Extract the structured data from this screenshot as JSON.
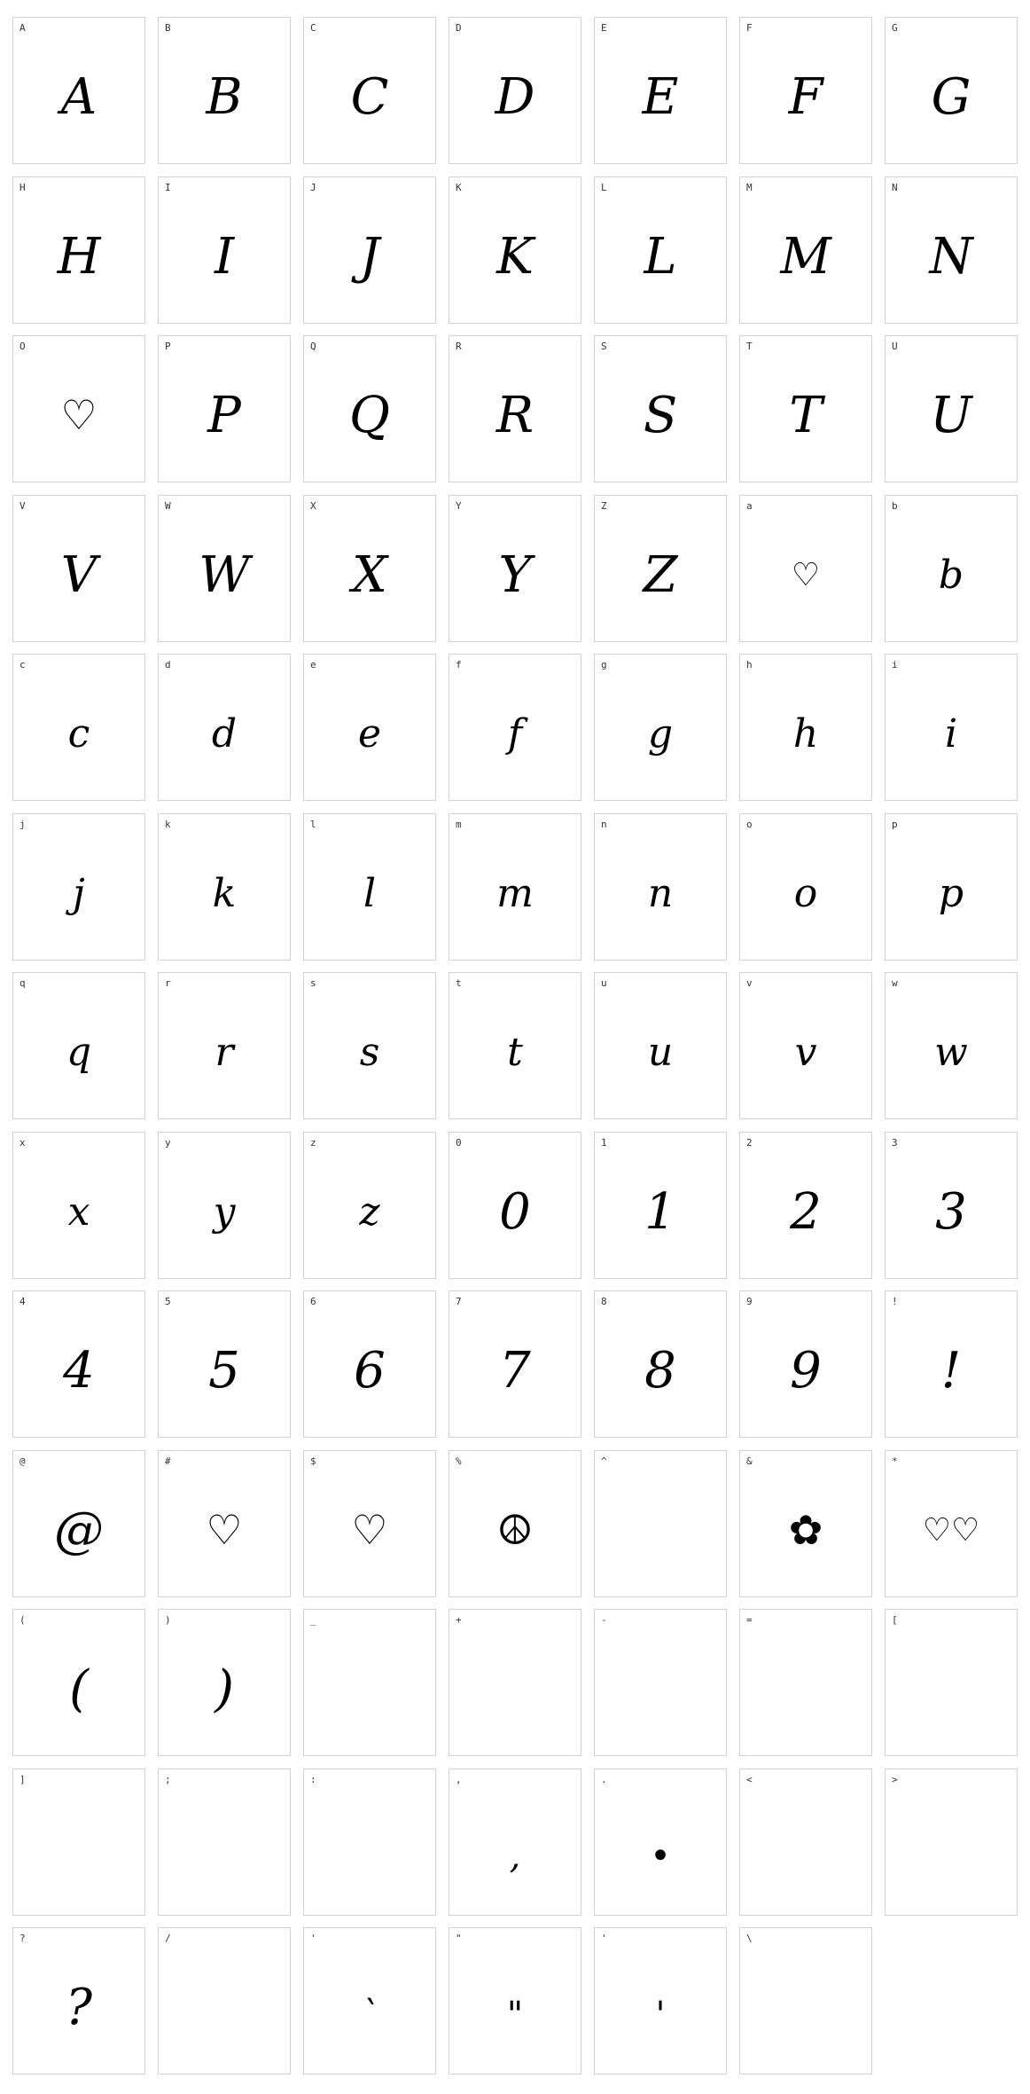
{
  "glyph_map": {
    "cells": [
      {
        "label": "A",
        "glyph": "A"
      },
      {
        "label": "B",
        "glyph": "B"
      },
      {
        "label": "C",
        "glyph": "C"
      },
      {
        "label": "D",
        "glyph": "D"
      },
      {
        "label": "E",
        "glyph": "E"
      },
      {
        "label": "F",
        "glyph": "F"
      },
      {
        "label": "G",
        "glyph": "G"
      },
      {
        "label": "H",
        "glyph": "H"
      },
      {
        "label": "I",
        "glyph": "I"
      },
      {
        "label": "J",
        "glyph": "J"
      },
      {
        "label": "K",
        "glyph": "K"
      },
      {
        "label": "L",
        "glyph": "L"
      },
      {
        "label": "M",
        "glyph": "M"
      },
      {
        "label": "N",
        "glyph": "N"
      },
      {
        "label": "O",
        "glyph": "♡",
        "style": "decor"
      },
      {
        "label": "P",
        "glyph": "P"
      },
      {
        "label": "Q",
        "glyph": "Q"
      },
      {
        "label": "R",
        "glyph": "R"
      },
      {
        "label": "S",
        "glyph": "S"
      },
      {
        "label": "T",
        "glyph": "T"
      },
      {
        "label": "U",
        "glyph": "U"
      },
      {
        "label": "V",
        "glyph": "V"
      },
      {
        "label": "W",
        "glyph": "W"
      },
      {
        "label": "X",
        "glyph": "X"
      },
      {
        "label": "Y",
        "glyph": "Y"
      },
      {
        "label": "Z",
        "glyph": "Z"
      },
      {
        "label": "a",
        "glyph": "♡",
        "style": "decor-small"
      },
      {
        "label": "b",
        "glyph": "b",
        "style": "small"
      },
      {
        "label": "c",
        "glyph": "c",
        "style": "small"
      },
      {
        "label": "d",
        "glyph": "d",
        "style": "small"
      },
      {
        "label": "e",
        "glyph": "e",
        "style": "small"
      },
      {
        "label": "f",
        "glyph": "f",
        "style": "small"
      },
      {
        "label": "g",
        "glyph": "g",
        "style": "small"
      },
      {
        "label": "h",
        "glyph": "h",
        "style": "small"
      },
      {
        "label": "i",
        "glyph": "i",
        "style": "small"
      },
      {
        "label": "j",
        "glyph": "j",
        "style": "small"
      },
      {
        "label": "k",
        "glyph": "k",
        "style": "small"
      },
      {
        "label": "l",
        "glyph": "l",
        "style": "small"
      },
      {
        "label": "m",
        "glyph": "m",
        "style": "small"
      },
      {
        "label": "n",
        "glyph": "n",
        "style": "small"
      },
      {
        "label": "o",
        "glyph": "o",
        "style": "small"
      },
      {
        "label": "p",
        "glyph": "p",
        "style": "small"
      },
      {
        "label": "q",
        "glyph": "q",
        "style": "small"
      },
      {
        "label": "r",
        "glyph": "r",
        "style": "small"
      },
      {
        "label": "s",
        "glyph": "s",
        "style": "small"
      },
      {
        "label": "t",
        "glyph": "t",
        "style": "small"
      },
      {
        "label": "u",
        "glyph": "u",
        "style": "small"
      },
      {
        "label": "v",
        "glyph": "v",
        "style": "small"
      },
      {
        "label": "w",
        "glyph": "w",
        "style": "small"
      },
      {
        "label": "x",
        "glyph": "x",
        "style": "small"
      },
      {
        "label": "y",
        "glyph": "y",
        "style": "small"
      },
      {
        "label": "z",
        "glyph": "z",
        "style": "small"
      },
      {
        "label": "0",
        "glyph": "0"
      },
      {
        "label": "1",
        "glyph": "1"
      },
      {
        "label": "2",
        "glyph": "2"
      },
      {
        "label": "3",
        "glyph": "3"
      },
      {
        "label": "4",
        "glyph": "4"
      },
      {
        "label": "5",
        "glyph": "5"
      },
      {
        "label": "6",
        "glyph": "6"
      },
      {
        "label": "7",
        "glyph": "7"
      },
      {
        "label": "8",
        "glyph": "8"
      },
      {
        "label": "9",
        "glyph": "9"
      },
      {
        "label": "!",
        "glyph": "!"
      },
      {
        "label": "@",
        "glyph": "@"
      },
      {
        "label": "#",
        "glyph": "♡",
        "style": "decor"
      },
      {
        "label": "$",
        "glyph": "♡",
        "style": "decor"
      },
      {
        "label": "%",
        "glyph": "☮",
        "style": "decor"
      },
      {
        "label": "^",
        "glyph": ""
      },
      {
        "label": "&",
        "glyph": "✿",
        "style": "decor"
      },
      {
        "label": "*",
        "glyph": "♡♡",
        "style": "decor-small"
      },
      {
        "label": "(",
        "glyph": "("
      },
      {
        "label": ")",
        "glyph": ")"
      },
      {
        "label": "_",
        "glyph": ""
      },
      {
        "label": "+",
        "glyph": ""
      },
      {
        "label": "-",
        "glyph": ""
      },
      {
        "label": "=",
        "glyph": ""
      },
      {
        "label": "[",
        "glyph": ""
      },
      {
        "label": "]",
        "glyph": ""
      },
      {
        "label": ";",
        "glyph": ""
      },
      {
        "label": ":",
        "glyph": ""
      },
      {
        "label": ",",
        "glyph": ",",
        "style": "punct"
      },
      {
        "label": ".",
        "glyph": "•",
        "style": "punct"
      },
      {
        "label": "<",
        "glyph": ""
      },
      {
        "label": ">",
        "glyph": ""
      },
      {
        "label": "?",
        "glyph": "?"
      },
      {
        "label": "/",
        "glyph": ""
      },
      {
        "label": "'",
        "glyph": "`",
        "style": "punct"
      },
      {
        "label": "\"",
        "glyph": "\"",
        "style": "punct"
      },
      {
        "label": "'",
        "glyph": "'",
        "style": "punct"
      },
      {
        "label": "\\",
        "glyph": ""
      }
    ]
  }
}
